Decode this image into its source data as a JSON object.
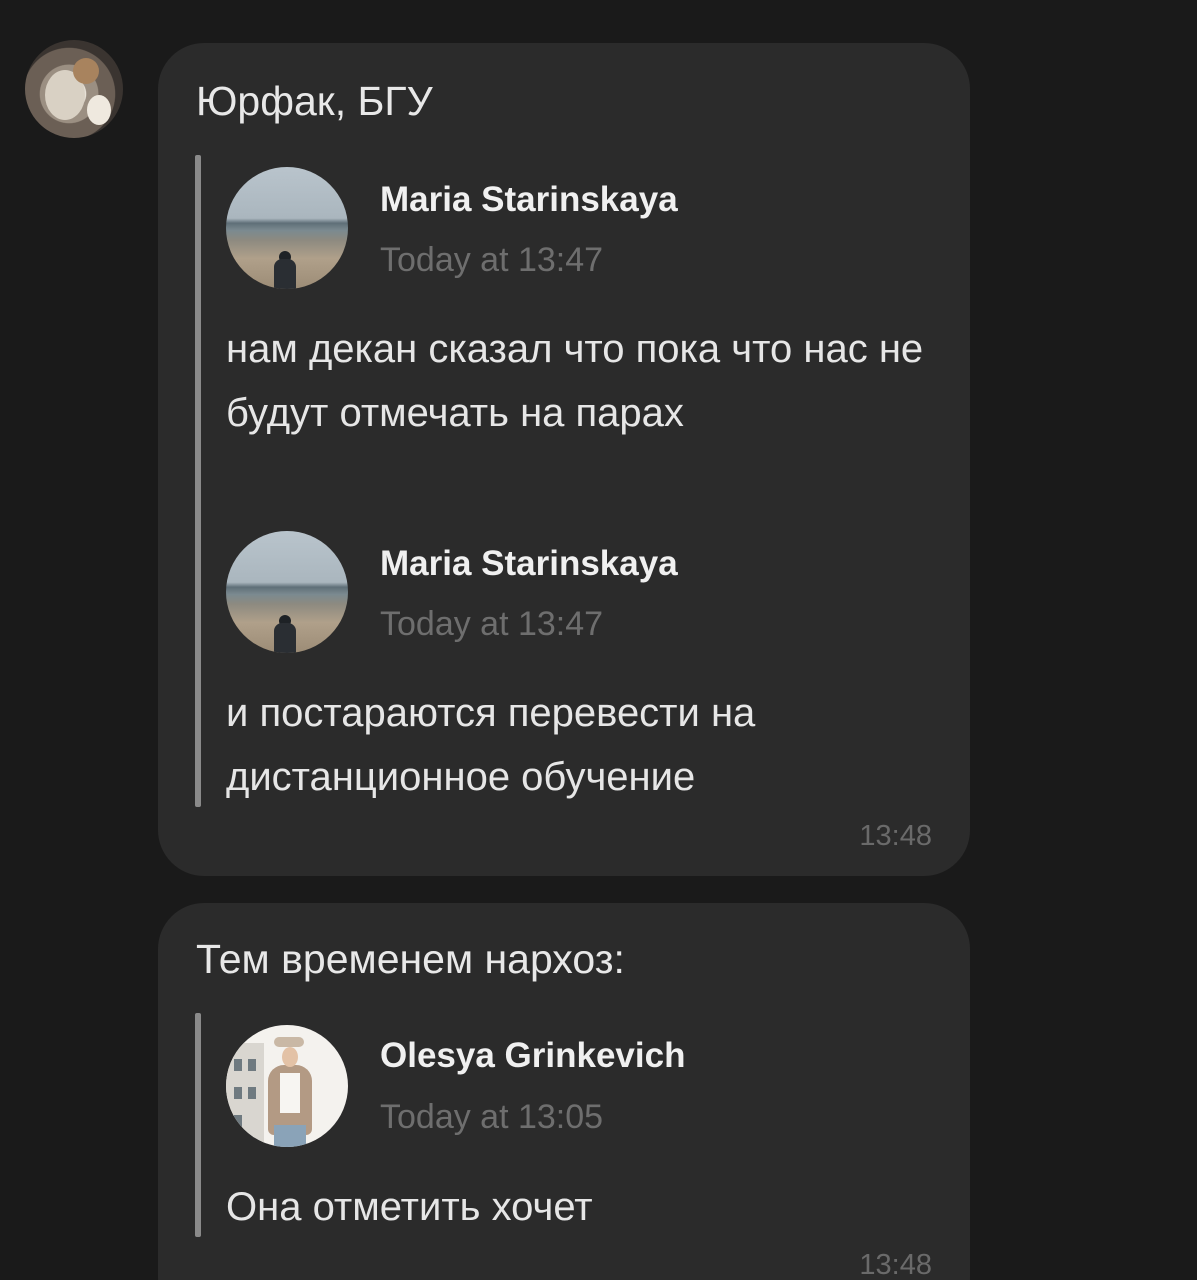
{
  "messages": [
    {
      "title": "Юрфак, БГУ",
      "forwards": [
        {
          "name": "Maria Starinskaya",
          "date": "Today at 13:47",
          "text": "нам декан сказал что пока что нас не будут отмечать на парах"
        },
        {
          "name": "Maria Starinskaya",
          "date": "Today at 13:47",
          "text": "и постараются перевести на дистанционное обучение"
        }
      ],
      "time": "13:48"
    },
    {
      "title": "Тем временем нархоз:",
      "forwards": [
        {
          "name": "Olesya Grinkevich",
          "date": "Today at 13:05",
          "text": "Она отметить хочет"
        }
      ],
      "time": "13:48"
    }
  ]
}
